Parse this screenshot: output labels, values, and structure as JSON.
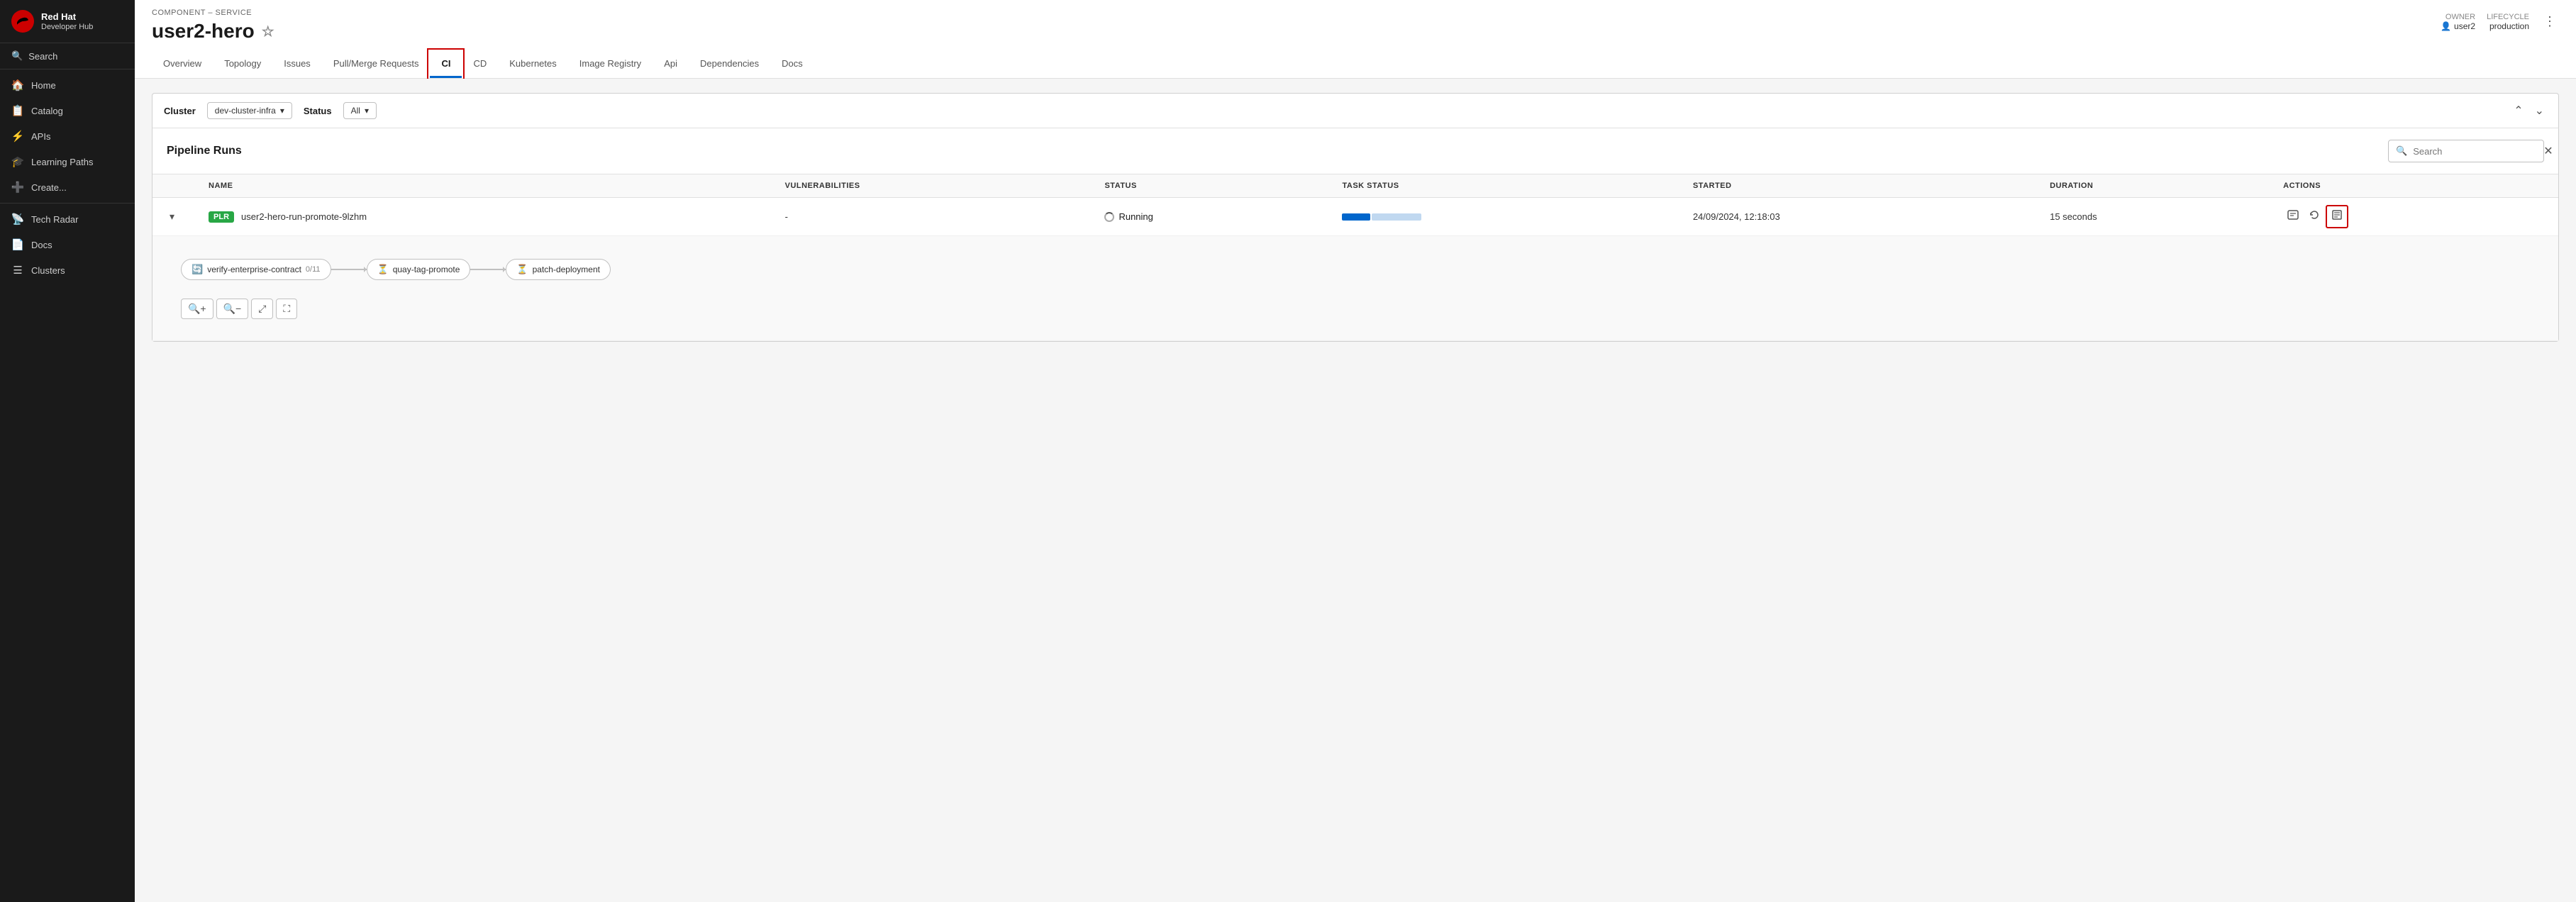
{
  "sidebar": {
    "brand": {
      "name": "Red Hat",
      "subtitle": "Developer Hub"
    },
    "search_label": "Search",
    "items": [
      {
        "id": "home",
        "label": "Home",
        "icon": "🏠"
      },
      {
        "id": "catalog",
        "label": "Catalog",
        "icon": "📋"
      },
      {
        "id": "apis",
        "label": "APIs",
        "icon": "⚡"
      },
      {
        "id": "learning-paths",
        "label": "Learning Paths",
        "icon": "🎓"
      },
      {
        "id": "create",
        "label": "Create...",
        "icon": "➕"
      },
      {
        "id": "tech-radar",
        "label": "Tech Radar",
        "icon": "📡"
      },
      {
        "id": "docs",
        "label": "Docs",
        "icon": "📄"
      },
      {
        "id": "clusters",
        "label": "Clusters",
        "icon": "☰"
      }
    ]
  },
  "header": {
    "breadcrumb": "COMPONENT – SERVICE",
    "title": "user2-hero",
    "owner_label": "Owner",
    "owner_value": "user2",
    "lifecycle_label": "Lifecycle",
    "lifecycle_value": "production"
  },
  "tabs": [
    {
      "id": "overview",
      "label": "Overview"
    },
    {
      "id": "topology",
      "label": "Topology"
    },
    {
      "id": "issues",
      "label": "Issues"
    },
    {
      "id": "pull-merge-requests",
      "label": "Pull/Merge Requests"
    },
    {
      "id": "ci",
      "label": "CI",
      "active": true
    },
    {
      "id": "cd",
      "label": "CD"
    },
    {
      "id": "kubernetes",
      "label": "Kubernetes"
    },
    {
      "id": "image-registry",
      "label": "Image Registry"
    },
    {
      "id": "api",
      "label": "Api"
    },
    {
      "id": "dependencies",
      "label": "Dependencies"
    },
    {
      "id": "docs",
      "label": "Docs"
    }
  ],
  "filter": {
    "cluster_label": "Cluster",
    "cluster_value": "dev-cluster-infra",
    "status_label": "Status",
    "status_value": "All"
  },
  "pipeline_runs": {
    "title": "Pipeline Runs",
    "search_placeholder": "Search",
    "columns": [
      "",
      "NAME",
      "VULNERABILITIES",
      "STATUS",
      "TASK STATUS",
      "STARTED",
      "DURATION",
      "ACTIONS"
    ],
    "rows": [
      {
        "badge": "PLR",
        "name": "user2-hero-run-promote-9lzhm",
        "vulnerabilities": "-",
        "status": "Running",
        "started": "24/09/2024, 12:18:03",
        "duration": "15 seconds"
      }
    ],
    "pipeline_nodes": [
      {
        "icon": "refresh",
        "label": "verify-enterprise-contract",
        "count": "0/11"
      },
      {
        "icon": "pending",
        "label": "quay-tag-promote",
        "count": ""
      },
      {
        "icon": "pending",
        "label": "patch-deployment",
        "count": ""
      }
    ]
  },
  "zoom_controls": {
    "zoom_in": "+",
    "zoom_out": "−",
    "fit": "⤢",
    "expand": "⛶"
  }
}
